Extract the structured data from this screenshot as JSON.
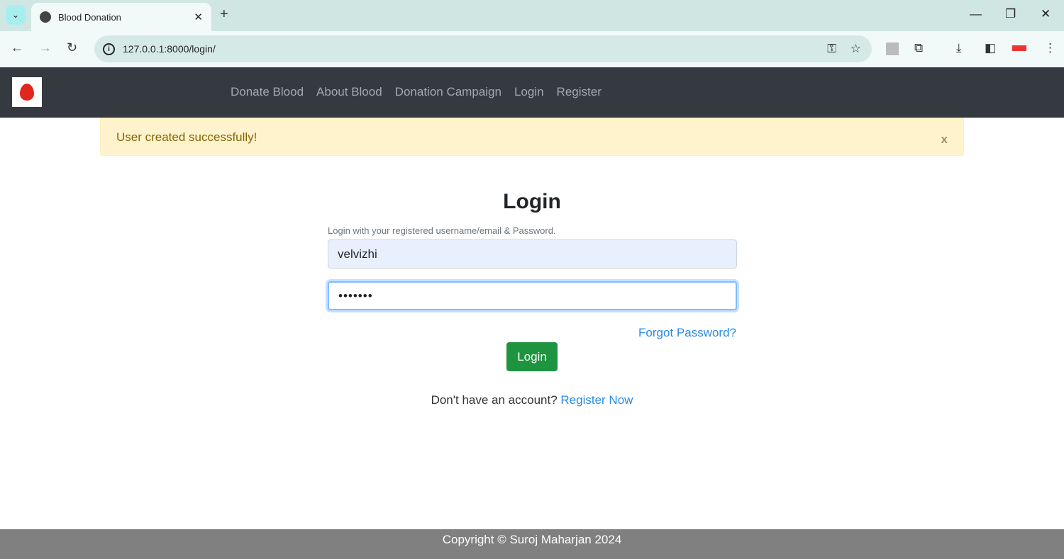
{
  "browser": {
    "tab_title": "Blood Donation",
    "url": "127.0.0.1:8000/login/"
  },
  "navbar": {
    "links": [
      "Donate Blood",
      "About Blood",
      "Donation Campaign",
      "Login",
      "Register"
    ]
  },
  "alert": {
    "message": "User created successfully!",
    "close": "x"
  },
  "login": {
    "title": "Login",
    "hint": "Login with your registered username/email & Password.",
    "username": "velvizhi",
    "password": "•••••••",
    "forgot": "Forgot Password?",
    "button": "Login",
    "register_prompt": "Don't have an account?",
    "register_link": "Register Now"
  },
  "footer": {
    "text": "Copyright © Suroj Maharjan 2024"
  }
}
